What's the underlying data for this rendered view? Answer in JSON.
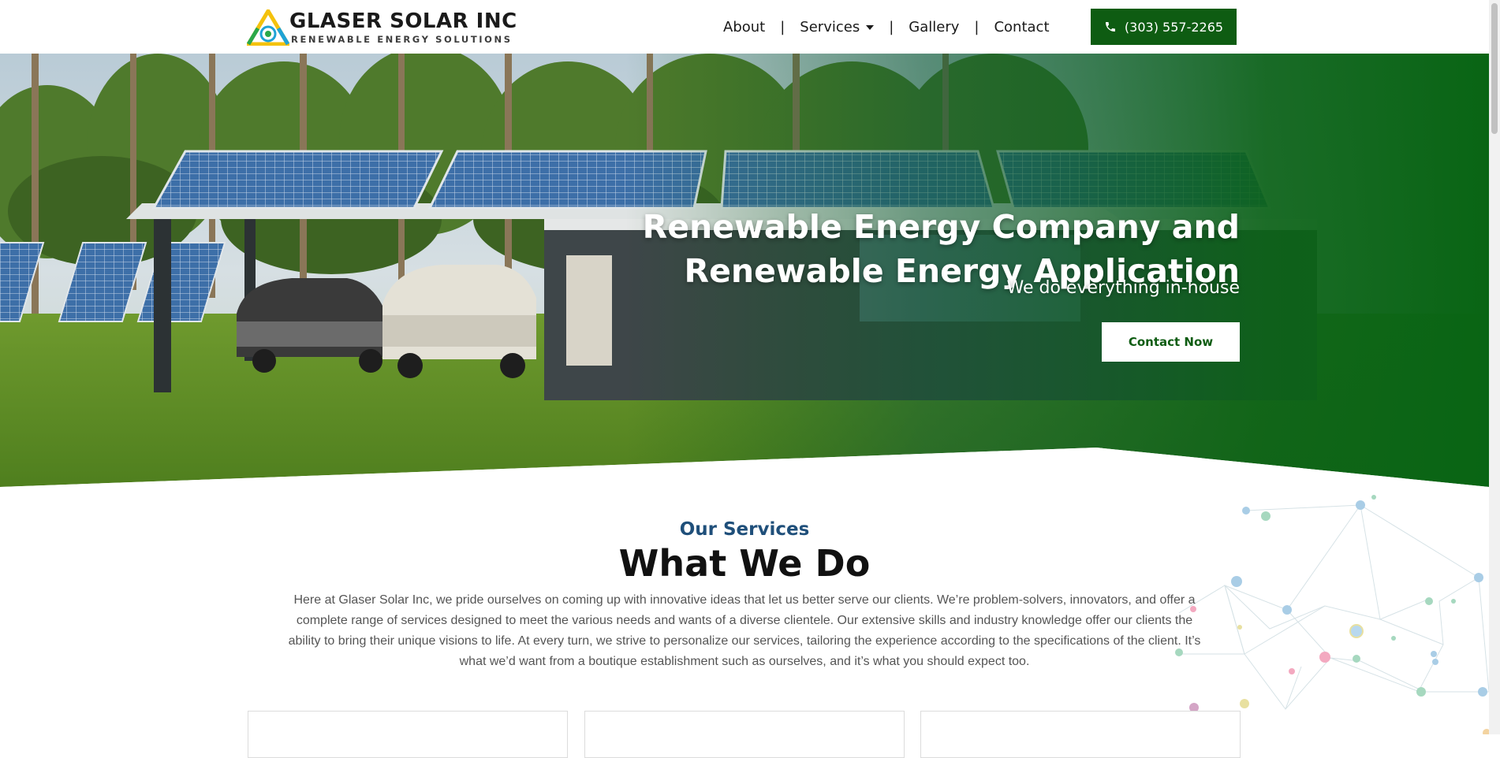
{
  "header": {
    "logo": {
      "name": "GLASER SOLAR INC",
      "tagline": "RENEWABLE ENERGY SOLUTIONS"
    },
    "nav": {
      "about": "About",
      "services": "Services",
      "gallery": "Gallery",
      "contact": "Contact",
      "separator": "|"
    },
    "phone": {
      "label": "(303) 557-2265",
      "icon": "phone-icon"
    }
  },
  "hero": {
    "title_line1": "Renewable Energy Company and",
    "title_line2": "Renewable Energy Application",
    "subtitle": "We do everything in-house",
    "cta_label": "Contact Now"
  },
  "services": {
    "eyebrow": "Our Services",
    "title": "What We Do",
    "body": "Here at Glaser Solar Inc, we pride ourselves on coming up with innovative ideas that let us better serve our clients. We’re problem-solvers, innovators, and offer a complete range of services designed to meet the various needs and wants of a diverse clientele. Our extensive skills and industry knowledge offer our clients the ability to bring their unique visions to life. At every turn, we strive to personalize our services, tailoring the experience according to the specifications of the client. It’s what we’d want from a boutique establishment such as ourselves, and it’s what you should expect too."
  },
  "colors": {
    "brand_green": "#0e5c12",
    "eyebrow_blue": "#1f4f7a",
    "body_gray": "#555555"
  }
}
